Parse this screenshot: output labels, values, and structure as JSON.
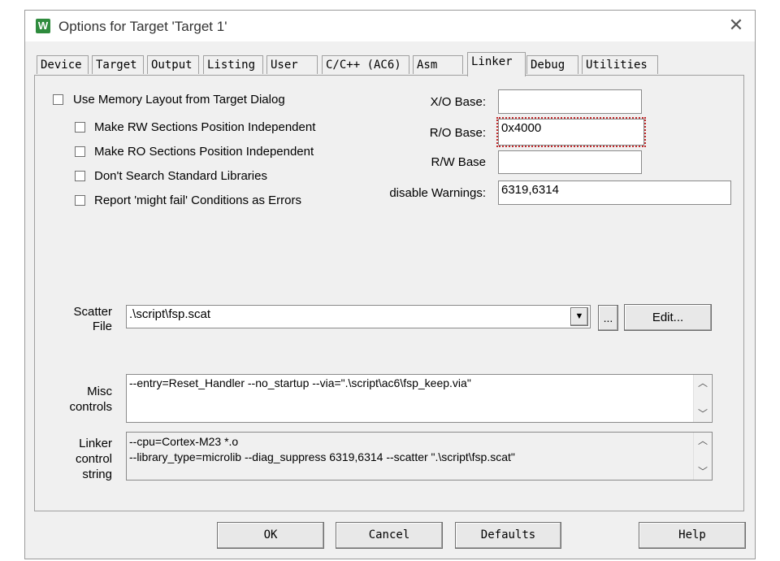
{
  "window": {
    "title": "Options for Target 'Target 1'",
    "app_icon": "W"
  },
  "tabs": [
    "Device",
    "Target",
    "Output",
    "Listing",
    "User",
    "C/C++ (AC6)",
    "Asm",
    "Linker",
    "Debug",
    "Utilities"
  ],
  "active_tab": "Linker",
  "checkboxes": {
    "use_memory_layout": "Use Memory Layout from Target Dialog",
    "rw_independent": "Make RW Sections Position Independent",
    "ro_independent": "Make RO Sections Position Independent",
    "no_std_libs": "Don't Search Standard Libraries",
    "might_fail": "Report 'might fail' Conditions as Errors"
  },
  "fields": {
    "xo_base": {
      "label": "X/O Base:",
      "value": ""
    },
    "ro_base": {
      "label": "R/O Base:",
      "value": "0x4000"
    },
    "rw_base": {
      "label": "R/W Base",
      "value": ""
    },
    "disable_warnings": {
      "label": "disable Warnings:",
      "value": "6319,6314"
    }
  },
  "scatter": {
    "label_line1": "Scatter",
    "label_line2": "File",
    "value": ".\\script\\fsp.scat",
    "browse_label": "...",
    "edit_label": "Edit..."
  },
  "misc": {
    "label_line1": "Misc",
    "label_line2": "controls",
    "value": "--entry=Reset_Handler --no_startup --via=\".\\script\\ac6\\fsp_keep.via\""
  },
  "linker": {
    "label_line1": "Linker",
    "label_line2": "control",
    "label_line3": "string",
    "line1": "--cpu=Cortex-M23 *.o",
    "line2": "--library_type=microlib --diag_suppress 6319,6314 --scatter \".\\script\\fsp.scat\""
  },
  "buttons": {
    "ok": "OK",
    "cancel": "Cancel",
    "defaults": "Defaults",
    "help": "Help"
  },
  "colors": {
    "focus_outline": "#c0282a",
    "app_icon_bg": "#2e8b3d"
  }
}
